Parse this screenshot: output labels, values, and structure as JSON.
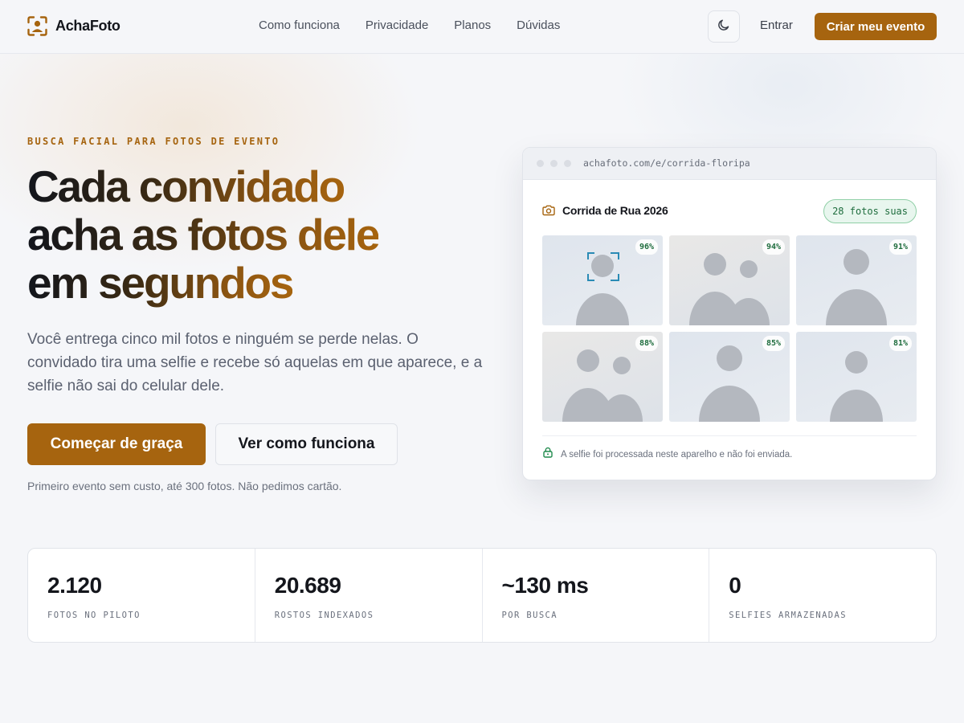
{
  "nav": {
    "brand": "AchaFoto",
    "links": [
      "Como funciona",
      "Privacidade",
      "Planos",
      "Dúvidas"
    ],
    "theme_icon": "moon-icon",
    "login": "Entrar",
    "cta": "Criar meu evento"
  },
  "hero": {
    "eyebrow": "BUSCA FACIAL PARA FOTOS DE EVENTO",
    "headline_lines": [
      "Cada convidado",
      "acha as fotos dele",
      "em segundos"
    ],
    "lead": "Você entrega cinco mil fotos e ninguém se perde nelas. O convidado tira uma selfie e recebe só aquelas em que aparece, e a selfie não sai do celular dele.",
    "primary_cta": "Começar de graça",
    "secondary_cta": "Ver como funciona",
    "fineprint": "Primeiro evento sem custo, até 300 fotos. Não pedimos cartão."
  },
  "mock": {
    "url": "achafoto.com/e/corrida-floripa",
    "event_icon": "camera-icon",
    "event_title": "Corrida de Rua 2026",
    "match_badge": "28 fotos suas",
    "photos": [
      {
        "match": "96%",
        "people": 1,
        "focused": true
      },
      {
        "match": "94%",
        "people": 2,
        "focused": false
      },
      {
        "match": "91%",
        "people": 1,
        "focused": false
      },
      {
        "match": "88%",
        "people": 2,
        "focused": false
      },
      {
        "match": "85%",
        "people": 1,
        "focused": false
      },
      {
        "match": "81%",
        "people": 1,
        "focused": false
      }
    ],
    "privacy_icon": "lock-icon",
    "privacy_note": "A selfie foi processada neste aparelho e não foi enviada."
  },
  "stats": [
    {
      "value": "2.120",
      "label": "FOTOS NO PILOTO"
    },
    {
      "value": "20.689",
      "label": "ROSTOS INDEXADOS"
    },
    {
      "value": "~130 ms",
      "label": "POR BUSCA"
    },
    {
      "value": "0",
      "label": "SELFIES ARMAZENADAS"
    }
  ],
  "colors": {
    "accent": "#a6640f",
    "match_green": "#1f6d3e",
    "text_dark": "#14161c",
    "background": "#f5f6f9"
  }
}
